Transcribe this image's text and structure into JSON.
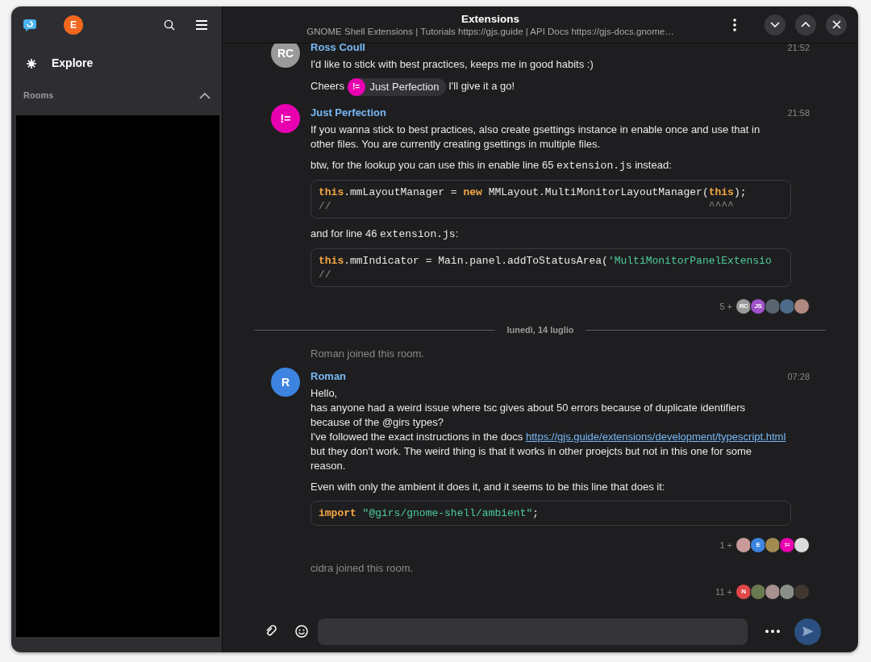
{
  "sidebar": {
    "account": {
      "initials": "E",
      "color": "#f2681e"
    },
    "nav_items": [
      {
        "label": "Explore",
        "selected": true
      }
    ],
    "sections": [
      {
        "title": "Rooms",
        "expanded": true
      }
    ]
  },
  "header": {
    "title": "Extensions",
    "topic": "GNOME Shell Extensions | Tutorials https://gjs.guide | API Docs https://gjs-docs.gnome…"
  },
  "timeline": [
    {
      "kind": "message",
      "sender": "Ross Coull",
      "initials": "RC",
      "color": "#9a9a9a",
      "time": "21:52",
      "paragraphs": [
        [
          {
            "kind": "text",
            "text": "I'd like to stick with best practices, keeps me in good habits :)"
          }
        ],
        [
          {
            "kind": "text",
            "text": "Cheers "
          },
          {
            "kind": "mention",
            "avatar": "!=",
            "color": "#e800b0",
            "text": "Just Perfection"
          },
          {
            "kind": "text",
            "text": " I'll give it a go!"
          }
        ]
      ]
    },
    {
      "kind": "message",
      "sender": "Just Perfection",
      "initials": "!=",
      "color": "#e800b0",
      "time": "21:58",
      "paragraphs": [
        [
          {
            "kind": "text",
            "text": "If you wanna stick to best practices, also create gsettings instance in enable once and use that in other files. You are currently creating gsettings in multiple files."
          }
        ],
        [
          {
            "kind": "text",
            "text": "btw, for the lookup you can use this in enable line 65 "
          },
          {
            "kind": "code",
            "text": "extension.js"
          },
          {
            "kind": "text",
            "text": " instead:"
          }
        ],
        {
          "kind": "code_block",
          "lines": [
            [
              {
                "kind": "keyword",
                "text": "this"
              },
              {
                "kind": "plain",
                "text": ".mmLayoutManager = "
              },
              {
                "kind": "keyword",
                "text": "new"
              },
              {
                "kind": "plain",
                "text": " MMLayout.MultiMonitorLayoutManager("
              },
              {
                "kind": "keyword",
                "text": "this"
              },
              {
                "kind": "plain",
                "text": ");"
              }
            ],
            [
              {
                "kind": "comment",
                "text": "//                                                            ^^^^"
              }
            ]
          ]
        },
        [
          {
            "kind": "text",
            "text": "and for line 46 "
          },
          {
            "kind": "code",
            "text": "extension.js"
          },
          {
            "kind": "text",
            "text": ":"
          }
        ],
        {
          "kind": "code_block",
          "lines": [
            [
              {
                "kind": "keyword",
                "text": "this"
              },
              {
                "kind": "plain",
                "text": ".mmIndicator = Main.panel.addToStatusArea("
              },
              {
                "kind": "string",
                "text": "'MultiMonitorPanelExtensio"
              }
            ],
            [
              {
                "kind": "comment",
                "text": "//"
              }
            ]
          ]
        }
      ]
    },
    {
      "kind": "receipts",
      "count": "5 +",
      "avatars": [
        {
          "initials": "RC",
          "color": "#9a9a9a"
        },
        {
          "initials": "JS",
          "color": "#a052c8"
        },
        {
          "color": "#5a6470"
        },
        {
          "color": "#4e6a8a"
        },
        {
          "color": "#b08a80"
        }
      ]
    },
    {
      "kind": "divider",
      "text": "lunedì, 14 luglio"
    },
    {
      "kind": "event",
      "text": "Roman joined this room."
    },
    {
      "kind": "message",
      "sender": "Roman",
      "initials": "R",
      "color": "#3d84e0",
      "time": "07:28",
      "paragraphs": [
        [
          {
            "kind": "text",
            "text": "Hello,\nhas anyone had a weird issue where tsc gives about 50 errors because of duplicate identifiers because of the @girs types?\nI've followed the exact instructions in the docs "
          },
          {
            "kind": "link",
            "text": "https://gjs.guide/extensions/development/typescript.html"
          },
          {
            "kind": "text",
            "text": " but they don't work. The weird thing is that it works in other proejcts but not in this one for some reason."
          }
        ],
        [
          {
            "kind": "text",
            "text": "Even with only the ambient it does it, and it seems to be this line that does it:"
          }
        ],
        {
          "kind": "code_block",
          "lines": [
            [
              {
                "kind": "keyword",
                "text": "import"
              },
              {
                "kind": "string",
                "text": " \"@girs/gnome-shell/ambient\""
              },
              {
                "kind": "plain",
                "text": ";"
              }
            ]
          ]
        }
      ]
    },
    {
      "kind": "receipts",
      "count": "1 +",
      "avatars": [
        {
          "color": "#c89a9a"
        },
        {
          "initials": "E",
          "color": "#3d84e0"
        },
        {
          "color": "#a08a50"
        },
        {
          "initials": "!=",
          "color": "#e800b0"
        },
        {
          "color": "#dcdcdc"
        }
      ]
    },
    {
      "kind": "event",
      "text": "cidra joined this room."
    },
    {
      "kind": "receipts",
      "count": "11 +",
      "avatars": [
        {
          "initials": "N",
          "color": "#e04848"
        },
        {
          "color": "#6a7a50"
        },
        {
          "color": "#a89090"
        },
        {
          "color": "#8a9088"
        },
        {
          "color": "#403830"
        }
      ]
    }
  ]
}
